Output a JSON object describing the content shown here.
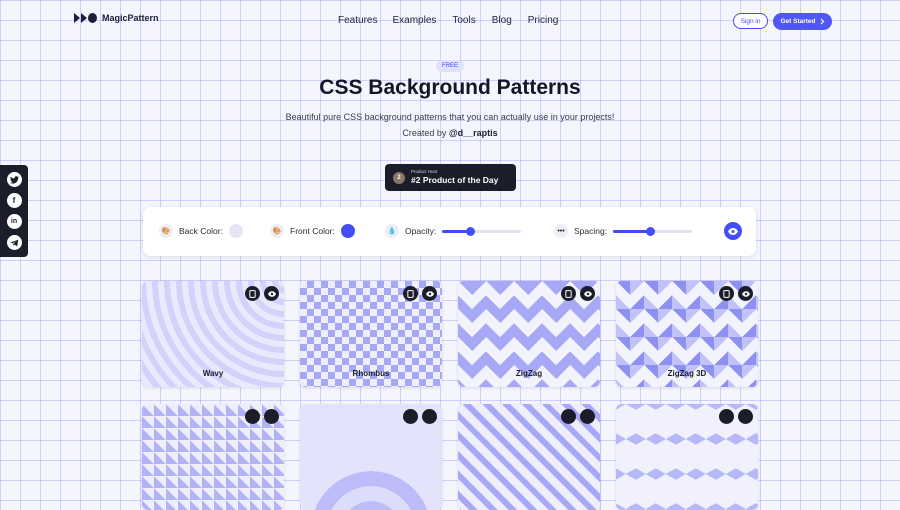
{
  "header": {
    "logo_text": "MagicPattern",
    "nav": [
      "Features",
      "Examples",
      "Tools",
      "Blog",
      "Pricing"
    ],
    "sign_in": "Sign in",
    "get_started": "Get Started"
  },
  "hero": {
    "badge": "FREE",
    "title": "CSS Background Patterns",
    "subtitle": "Beautiful pure CSS background patterns that you can actually use in your projects!",
    "created_by_prefix": "Created by",
    "author": "@d__raptis"
  },
  "product_hunt": {
    "small": "Product Hunt",
    "big": "#2 Product of the Day",
    "medal": "2"
  },
  "social": [
    "twitter-icon",
    "facebook-icon",
    "linkedin-icon",
    "telegram-icon"
  ],
  "controls": {
    "back_color_label": "Back Color:",
    "back_color": "#e5e5f7",
    "front_color_label": "Front Color:",
    "front_color": "#444cf7",
    "opacity_label": "Opacity:",
    "opacity_value": 0.35,
    "spacing_label": "Spacing:",
    "spacing_value": 0.47
  },
  "patterns": [
    "Wavy",
    "Rhombus",
    "ZigZag",
    "ZigZag 3D"
  ],
  "colors": {
    "accent": "#444cf7",
    "dark": "#1b1d2a"
  }
}
